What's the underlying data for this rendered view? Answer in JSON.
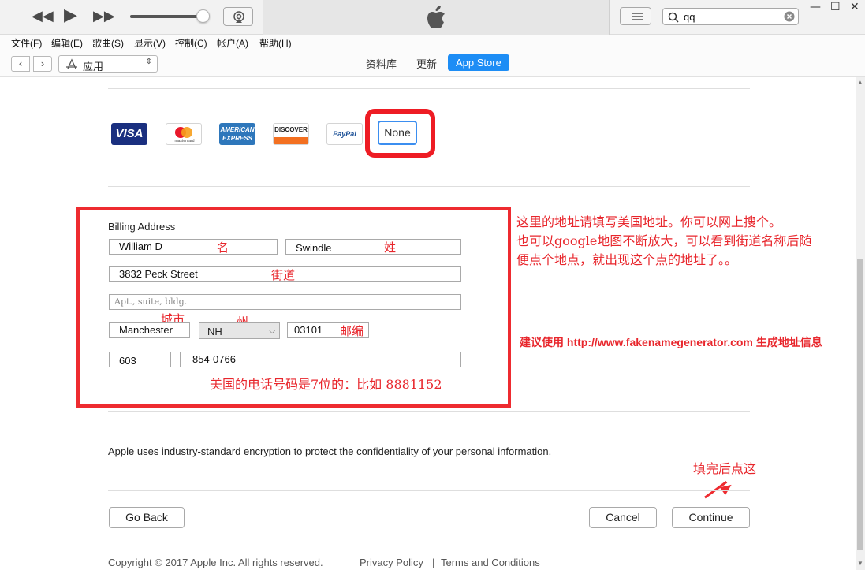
{
  "menu": [
    "文件(F)",
    "编辑(E)",
    "歌曲(S)",
    "显示(V)",
    "控制(C)",
    "帐户(A)",
    "帮助(H)"
  ],
  "search": {
    "value": "qq"
  },
  "nav": {
    "media_select": "应用",
    "tabs": [
      "资料库",
      "更新",
      "App Store"
    ],
    "active_tab": "App Store"
  },
  "payment": {
    "cards": [
      "VISA",
      "mastercard",
      "AMERICAN EXPRESS",
      "DISCOVER",
      "PayPal"
    ],
    "none_label": "None"
  },
  "billing": {
    "title": "Billing Address",
    "first_name": "William D",
    "last_name": "Swindle",
    "street": "3832 Peck Street",
    "apt_placeholder": "Apt., suite, bldg.",
    "city": "Manchester",
    "state": "NH",
    "zip": "03101",
    "area_code": "603",
    "phone": "854-0766"
  },
  "annotations": {
    "first_name": "名",
    "last_name": "姓",
    "street": "街道",
    "city": "城市",
    "state": "州",
    "zip": "邮编",
    "phone_note": "美国的电话号码是7位的：比如 8881152",
    "address_note_1": "这里的地址请填写美国地址。你可以网上搜个。",
    "address_note_2": "也可以google地图不断放大，可以看到街道名称后随",
    "address_note_3": "便点个地点，就出现这个点的地址了。。",
    "site_note": "建议使用 http://www.fakenamegenerator.com 生成地址信息",
    "continue_note": "填完后点这"
  },
  "encryption_text": "Apple uses industry-standard encryption to protect the confidentiality of your personal information.",
  "buttons": {
    "go_back": "Go Back",
    "cancel": "Cancel",
    "continue": "Continue"
  },
  "footer": {
    "copyright": "Copyright © 2017 Apple Inc. All rights reserved.",
    "privacy": "Privacy Policy",
    "separator": "|",
    "terms": "Terms and Conditions"
  },
  "colors": {
    "accent": "#1d8df5",
    "annotation_red": "#e8262c"
  }
}
